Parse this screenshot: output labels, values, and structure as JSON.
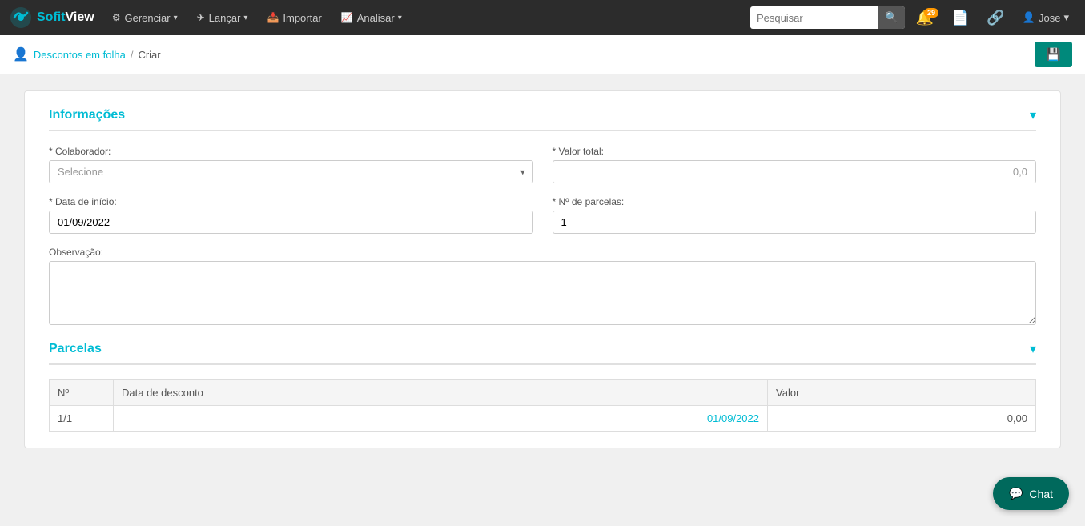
{
  "brand": {
    "sofit": "Sofit",
    "view": "View"
  },
  "navbar": {
    "items": [
      {
        "label": "Gerenciar",
        "icon": "⚙"
      },
      {
        "label": "Lançar",
        "icon": "✈"
      },
      {
        "label": "Importar",
        "icon": "📥"
      },
      {
        "label": "Analisar",
        "icon": "📈"
      }
    ],
    "search_placeholder": "Pesquisar",
    "notification_count": "29",
    "user_label": "Jose"
  },
  "breadcrumb": {
    "icon": "👤",
    "link_label": "Descontos em folha",
    "separator": "/",
    "current": "Criar"
  },
  "save_button_icon": "💾",
  "informacoes": {
    "title": "Informações",
    "colaborador_label": "* Colaborador:",
    "colaborador_placeholder": "Selecione",
    "valor_total_label": "* Valor total:",
    "valor_total_placeholder": "0,0",
    "data_inicio_label": "* Data de início:",
    "data_inicio_value": "01/09/2022",
    "num_parcelas_label": "* Nº de parcelas:",
    "num_parcelas_value": "1",
    "observacao_label": "Observação:"
  },
  "parcelas": {
    "title": "Parcelas",
    "columns": [
      "Nº",
      "Data de desconto",
      "Valor"
    ],
    "rows": [
      {
        "num": "1/1",
        "data": "01/09/2022",
        "valor": "0,00"
      }
    ]
  },
  "chat": {
    "label": "Chat"
  }
}
